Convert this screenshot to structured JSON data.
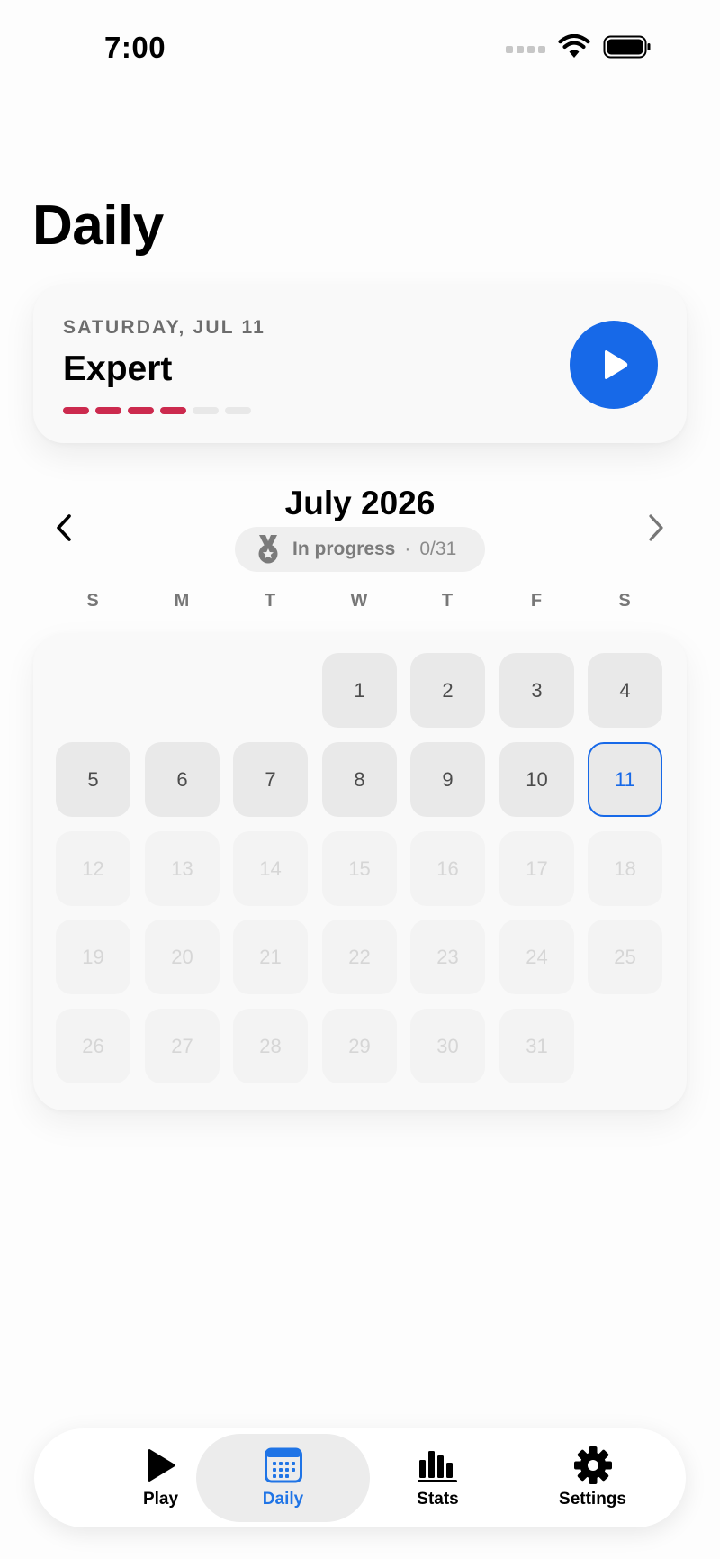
{
  "status_bar": {
    "time": "7:00"
  },
  "page": {
    "title": "Daily"
  },
  "daily_card": {
    "date": "SATURDAY, JUL 11",
    "difficulty": "Expert",
    "difficulty_level": 4,
    "difficulty_max": 6,
    "difficulty_color": "#cc2a4e",
    "play_icon": "play-icon",
    "accent_color": "#1769e8"
  },
  "calendar": {
    "month_title": "July 2026",
    "prev_icon": "chevron-left-icon",
    "next_icon": "chevron-right-icon",
    "progress": {
      "icon": "medal-icon",
      "status": "In progress",
      "separator": "·",
      "count": "0/31"
    },
    "weekdays": [
      "S",
      "M",
      "T",
      "W",
      "T",
      "F",
      "S"
    ],
    "first_weekday_index": 3,
    "days": [
      {
        "label": "1",
        "state": "past"
      },
      {
        "label": "2",
        "state": "past"
      },
      {
        "label": "3",
        "state": "past"
      },
      {
        "label": "4",
        "state": "past"
      },
      {
        "label": "5",
        "state": "past"
      },
      {
        "label": "6",
        "state": "past"
      },
      {
        "label": "7",
        "state": "past"
      },
      {
        "label": "8",
        "state": "past"
      },
      {
        "label": "9",
        "state": "past"
      },
      {
        "label": "10",
        "state": "past"
      },
      {
        "label": "11",
        "state": "today"
      },
      {
        "label": "12",
        "state": "future"
      },
      {
        "label": "13",
        "state": "future"
      },
      {
        "label": "14",
        "state": "future"
      },
      {
        "label": "15",
        "state": "future"
      },
      {
        "label": "16",
        "state": "future"
      },
      {
        "label": "17",
        "state": "future"
      },
      {
        "label": "18",
        "state": "future"
      },
      {
        "label": "19",
        "state": "future"
      },
      {
        "label": "20",
        "state": "future"
      },
      {
        "label": "21",
        "state": "future"
      },
      {
        "label": "22",
        "state": "future"
      },
      {
        "label": "23",
        "state": "future"
      },
      {
        "label": "24",
        "state": "future"
      },
      {
        "label": "25",
        "state": "future"
      },
      {
        "label": "26",
        "state": "future"
      },
      {
        "label": "27",
        "state": "future"
      },
      {
        "label": "28",
        "state": "future"
      },
      {
        "label": "29",
        "state": "future"
      },
      {
        "label": "30",
        "state": "future"
      },
      {
        "label": "31",
        "state": "future"
      }
    ]
  },
  "tab_bar": {
    "tabs": [
      {
        "label": "Play",
        "icon": "play-icon",
        "active": false
      },
      {
        "label": "Daily",
        "icon": "calendar-icon",
        "active": true
      },
      {
        "label": "Stats",
        "icon": "bar-chart-icon",
        "active": false
      },
      {
        "label": "Settings",
        "icon": "gear-icon",
        "active": false
      }
    ],
    "active_color": "#1f74e6"
  }
}
